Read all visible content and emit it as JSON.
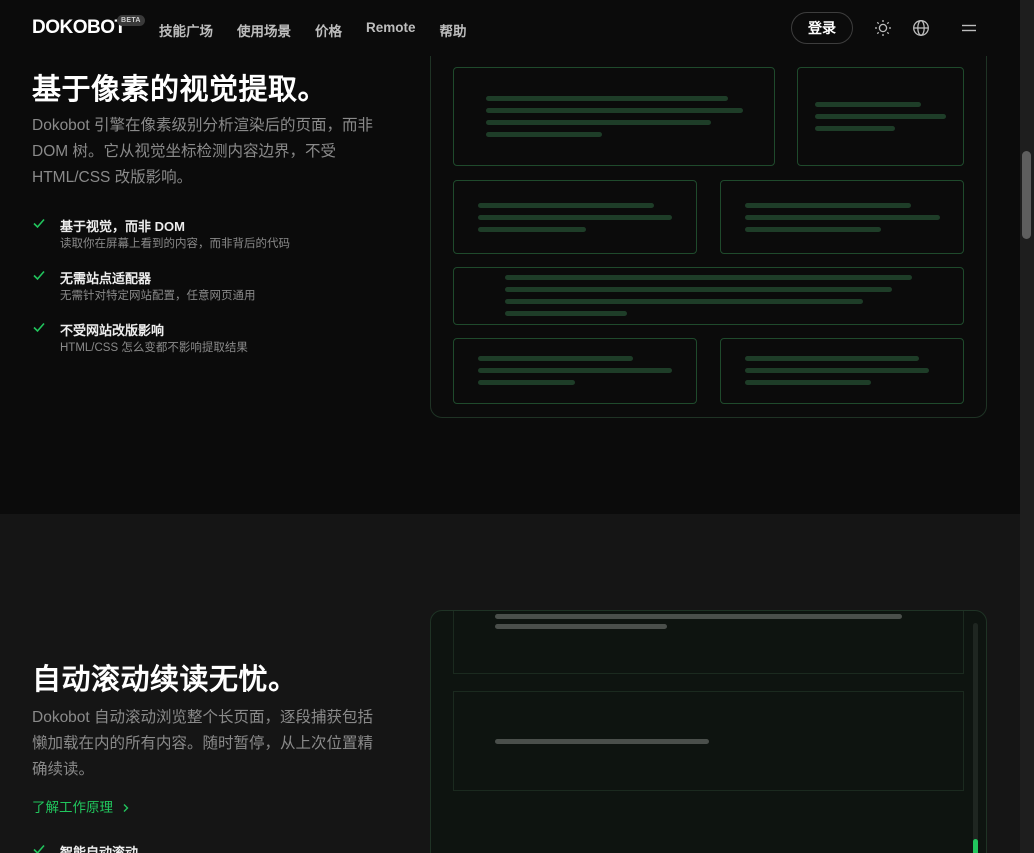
{
  "header": {
    "logo": "DOKOBOT",
    "beta": "BETA",
    "nav": [
      "技能广场",
      "使用场景",
      "价格",
      "Remote",
      "帮助"
    ],
    "login": "登录",
    "icons": [
      "sun-icon",
      "globe-icon",
      "menu-icon"
    ]
  },
  "section1": {
    "title": "基于像素的视觉提取。",
    "desc_lines": [
      "Dokobot 引擎在像素级别分析渲染后的页面，而非",
      "DOM 树。它从视觉坐标检测内容边界，不受",
      "HTML/CSS 改版影响。"
    ],
    "features": [
      {
        "title": "基于视觉，而非 DOM",
        "sub": "读取你在屏幕上看到的内容，而非背后的代码"
      },
      {
        "title": "无需站点适配器",
        "sub": "无需针对特定网站配置，任意网页通用"
      },
      {
        "title": "不受网站改版影响",
        "sub": "HTML/CSS 怎么变都不影响提取结果"
      }
    ]
  },
  "section2": {
    "title": "自动滚动续读无忧。",
    "desc_lines": [
      "Dokobot 自动滚动浏览整个长页面，逐段捕获包括",
      "懒加载在内的所有内容。随时暂停，从上次位置精",
      "确续读。"
    ],
    "link": "了解工作原理",
    "feature_partial": "智能自动滚动"
  },
  "colors": {
    "accent": "#21c55d",
    "background": "#0b0b0b",
    "section_alt": "#151515",
    "muted_text": "#8a8a8a"
  }
}
